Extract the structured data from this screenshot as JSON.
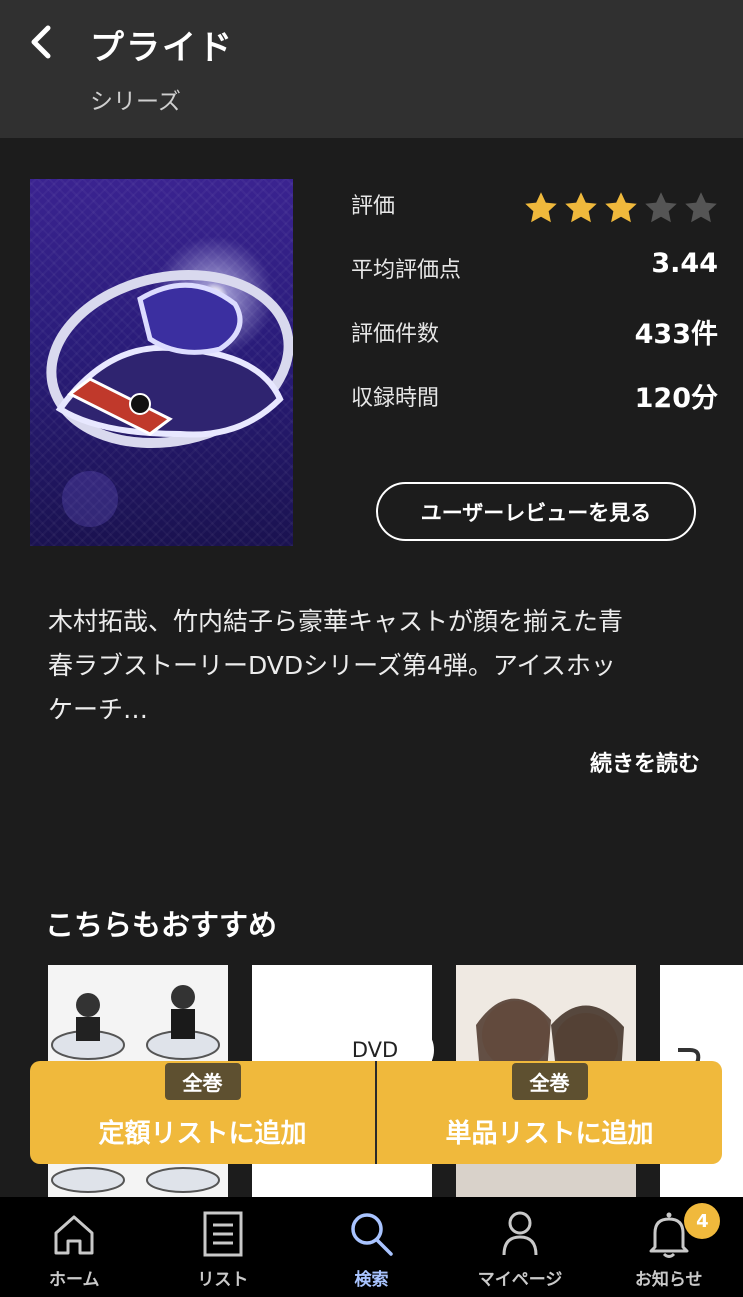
{
  "header": {
    "title": "プライド",
    "subtitle": "シリーズ"
  },
  "rating": {
    "label": "評価",
    "stars_filled": 3,
    "stars_total": 5,
    "star_color": "#f0b93c",
    "star_empty_color": "#555555"
  },
  "stats": {
    "average_label": "平均評価点",
    "average_value": "3.44",
    "count_label": "評価件数",
    "count_value": "433件",
    "duration_label": "収録時間",
    "duration_value": "120分"
  },
  "review_button": "ユーザーレビューを見る",
  "description": {
    "lines": [
      "木村拓哉、竹内結子ら豪華キャストが顔を揃えた青",
      "春ラブストーリーDVDシリーズ第4弾。アイスホッ",
      "ケーチ…"
    ],
    "read_more": "続きを読む"
  },
  "recommend": {
    "title": "こちらもおすすめ"
  },
  "actions": {
    "dvd_label": "DVD",
    "left_badge": "全巻",
    "left_label": "定額リストに追加",
    "right_badge": "全巻",
    "right_label": "単品リストに追加"
  },
  "nav": {
    "items": [
      {
        "label": "ホーム",
        "icon": "home-icon"
      },
      {
        "label": "リスト",
        "icon": "list-icon"
      },
      {
        "label": "検索",
        "icon": "search-icon"
      },
      {
        "label": "マイページ",
        "icon": "user-icon"
      },
      {
        "label": "お知らせ",
        "icon": "bell-icon"
      }
    ],
    "active_index": 2,
    "notification_count": "4"
  },
  "colors": {
    "accent": "#f0b93c",
    "background": "#1c1c1c",
    "header": "#303030",
    "nav_active": "#a9c4ff"
  }
}
